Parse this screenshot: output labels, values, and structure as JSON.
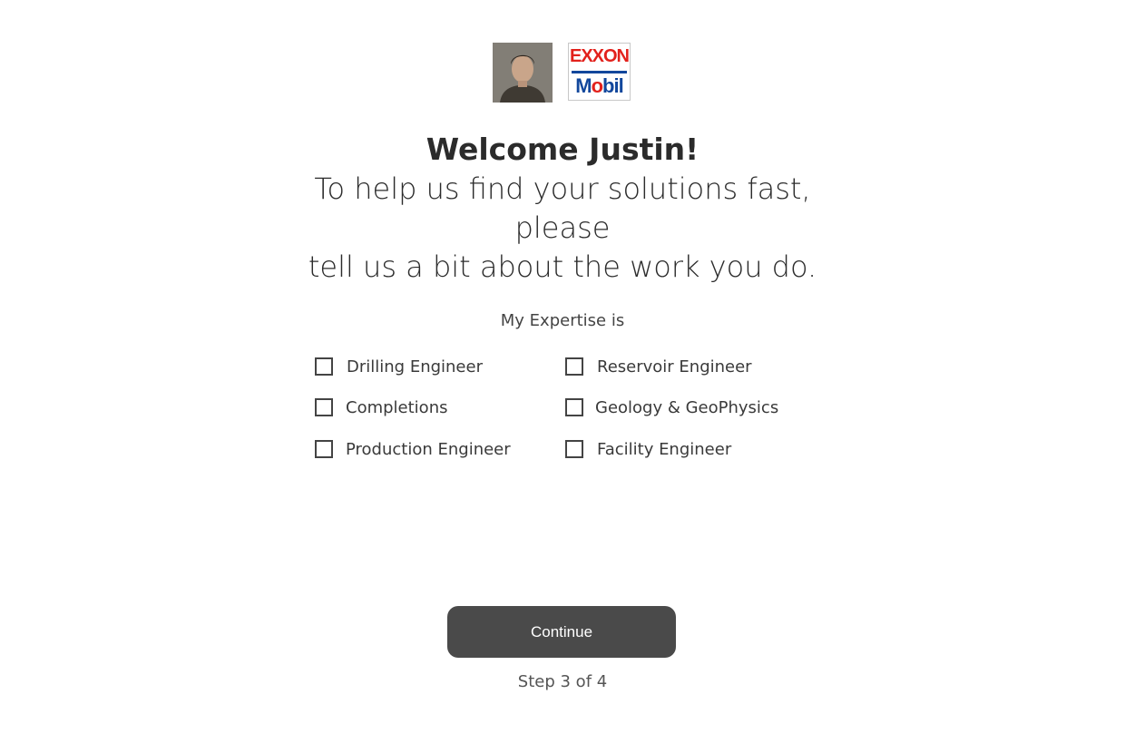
{
  "user": {
    "avatar_icon": "user-photo"
  },
  "brand": {
    "logo_top": "EXXON",
    "logo_bottom_prefix": "M",
    "logo_bottom_o": "o",
    "logo_bottom_suffix": "bil",
    "red": "#e2211c",
    "blue": "#12479c"
  },
  "header": {
    "welcome": "Welcome Justin!",
    "intro_line1": "To help us find your solutions fast, please",
    "intro_line2": "tell us a bit about the work you do."
  },
  "form": {
    "expertise_label": "My Expertise is",
    "options": [
      {
        "label": "Drilling Engineer",
        "checked": false
      },
      {
        "label": "Reservoir Engineer",
        "checked": false
      },
      {
        "label": "Completions",
        "checked": false
      },
      {
        "label": "Geology & GeoPhysics",
        "checked": false
      },
      {
        "label": "Production Engineer",
        "checked": false
      },
      {
        "label": "Facility Engineer",
        "checked": false
      }
    ]
  },
  "footer": {
    "continue_label": "Continue",
    "step_text": "Step 3 of 4",
    "button_color": "#4a4a4a"
  }
}
